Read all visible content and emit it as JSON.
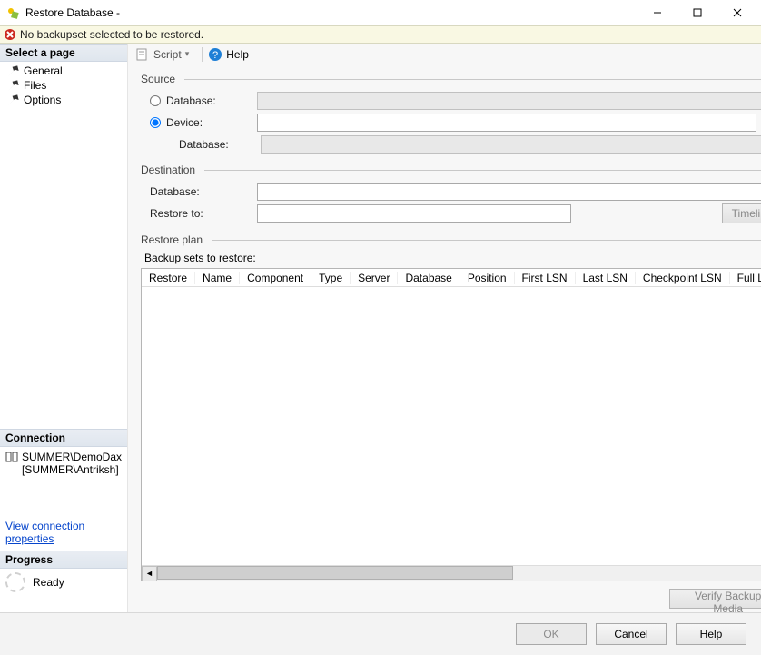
{
  "titlebar": {
    "title": "Restore Database -"
  },
  "warning": {
    "text": "No backupset selected to be restored."
  },
  "sidebar": {
    "select_page_header": "Select a page",
    "pages": [
      {
        "label": "General"
      },
      {
        "label": "Files"
      },
      {
        "label": "Options"
      }
    ],
    "connection_header": "Connection",
    "connection_server": "SUMMER\\DemoDax",
    "connection_user": "[SUMMER\\Antriksh]",
    "view_connection_link": "View connection properties",
    "progress_header": "Progress",
    "progress_status": "Ready"
  },
  "toolbar": {
    "script_label": "Script",
    "help_label": "Help"
  },
  "source": {
    "group_title": "Source",
    "database_radio_label": "Database:",
    "device_radio_label": "Device:",
    "device_value": "",
    "sub_database_label": "Database:"
  },
  "destination": {
    "group_title": "Destination",
    "database_label": "Database:",
    "database_value": "",
    "restore_to_label": "Restore to:",
    "restore_to_value": "",
    "timeline_btn": "Timeline..."
  },
  "restore_plan": {
    "group_title": "Restore plan",
    "subtitle": "Backup sets to restore:",
    "columns": [
      "Restore",
      "Name",
      "Component",
      "Type",
      "Server",
      "Database",
      "Position",
      "First LSN",
      "Last LSN",
      "Checkpoint LSN",
      "Full LSN"
    ],
    "verify_btn": "Verify Backup Media"
  },
  "footer": {
    "ok": "OK",
    "cancel": "Cancel",
    "help": "Help"
  }
}
